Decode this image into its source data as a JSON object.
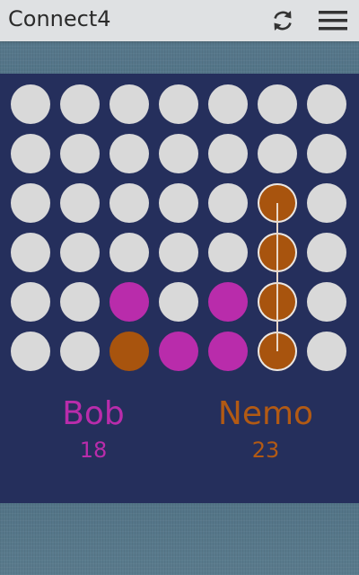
{
  "header": {
    "title": "Connect4",
    "refresh_icon": "refresh-icon",
    "menu_icon": "hamburger-menu-icon"
  },
  "board": {
    "columns": 7,
    "rows": 6,
    "cells": [
      [
        0,
        0,
        0,
        0,
        0,
        0,
        0
      ],
      [
        0,
        0,
        0,
        0,
        0,
        0,
        0
      ],
      [
        0,
        0,
        0,
        0,
        0,
        2,
        0
      ],
      [
        0,
        0,
        0,
        0,
        0,
        2,
        0
      ],
      [
        0,
        0,
        1,
        0,
        1,
        2,
        0
      ],
      [
        0,
        0,
        2,
        1,
        1,
        2,
        0
      ]
    ],
    "winning_column": 5,
    "winning_rows": [
      2,
      3,
      4,
      5
    ]
  },
  "players": [
    {
      "name": "Bob",
      "score": "18",
      "color": "#b92cab"
    },
    {
      "name": "Nemo",
      "score": "23",
      "color": "#a8540e"
    }
  ],
  "colors": {
    "empty": "#d9d9d9",
    "panel": "#252f5c",
    "topbar": "#dfe1e3"
  }
}
